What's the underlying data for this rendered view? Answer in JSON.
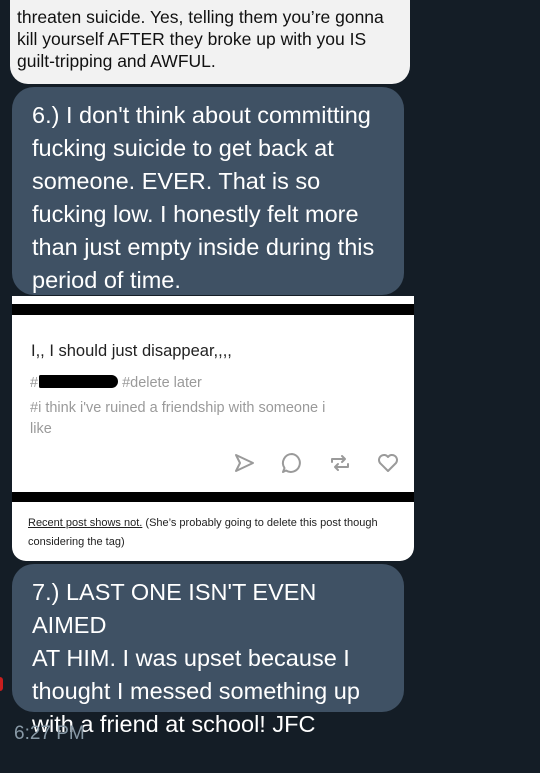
{
  "messages": {
    "top_white": {
      "lines": [
        "threaten suicide. Yes, telling them you’re gonna",
        "kill yourself AFTER they broke up with you IS",
        "guilt-tripping and AWFUL."
      ]
    },
    "msg6": {
      "lines": [
        "6.) I don't think about committing",
        "fucking suicide to get back at",
        "someone. EVER. That is so",
        "fucking low. I honestly felt more",
        "than just empty inside during this",
        "period of time."
      ]
    },
    "image_post": {
      "title": "I,, I should just disappear,,,,",
      "tag_prefix": "#",
      "tag_delete": "#delete later",
      "tag_text": "#i think i've ruined a friendship with someone i like",
      "caption_link": "Recent post shows not.",
      "caption_rest": " (She’s probably going to delete this post though considering the tag)"
    },
    "msg7": {
      "lines": [
        "7.) LAST ONE ISN'T EVEN AIMED",
        "AT HIM. I was upset because I",
        "thought I messed something up",
        "with a friend at school! JFC"
      ]
    }
  },
  "timestamp": "6:27 PM",
  "icons": [
    "send-icon",
    "comment-icon",
    "reblog-icon",
    "heart-icon"
  ],
  "colors": {
    "background": "#141d26",
    "bubble": "#3f5164",
    "white_bubble": "#f2f2f2",
    "timestamp": "#8899a6"
  }
}
